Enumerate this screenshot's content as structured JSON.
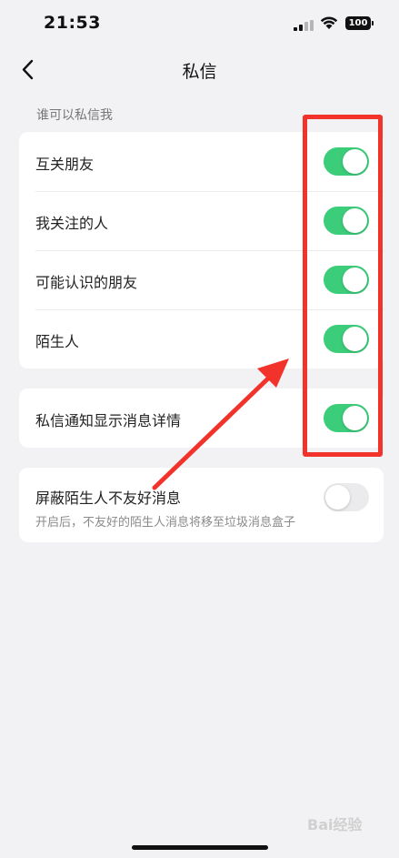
{
  "status_bar": {
    "time": "21:53",
    "battery": "100"
  },
  "nav": {
    "title": "私信",
    "back_icon": "chevron-left-icon"
  },
  "section": {
    "label": "谁可以私信我"
  },
  "who_can_message": [
    {
      "label": "互关朋友",
      "enabled": true
    },
    {
      "label": "我关注的人",
      "enabled": true
    },
    {
      "label": "可能认识的朋友",
      "enabled": true
    },
    {
      "label": "陌生人",
      "enabled": true
    }
  ],
  "notification": {
    "label": "私信通知显示消息详情",
    "enabled": true
  },
  "block_strangers": {
    "label": "屏蔽陌生人不友好消息",
    "description": "开启后，不友好的陌生人消息将移至垃圾消息盒子",
    "enabled": false
  },
  "watermark": {
    "text": "Bai经验"
  },
  "colors": {
    "toggle_on": "#3bcd7a",
    "toggle_off": "#ebebed",
    "annotation": "#f2332b"
  }
}
